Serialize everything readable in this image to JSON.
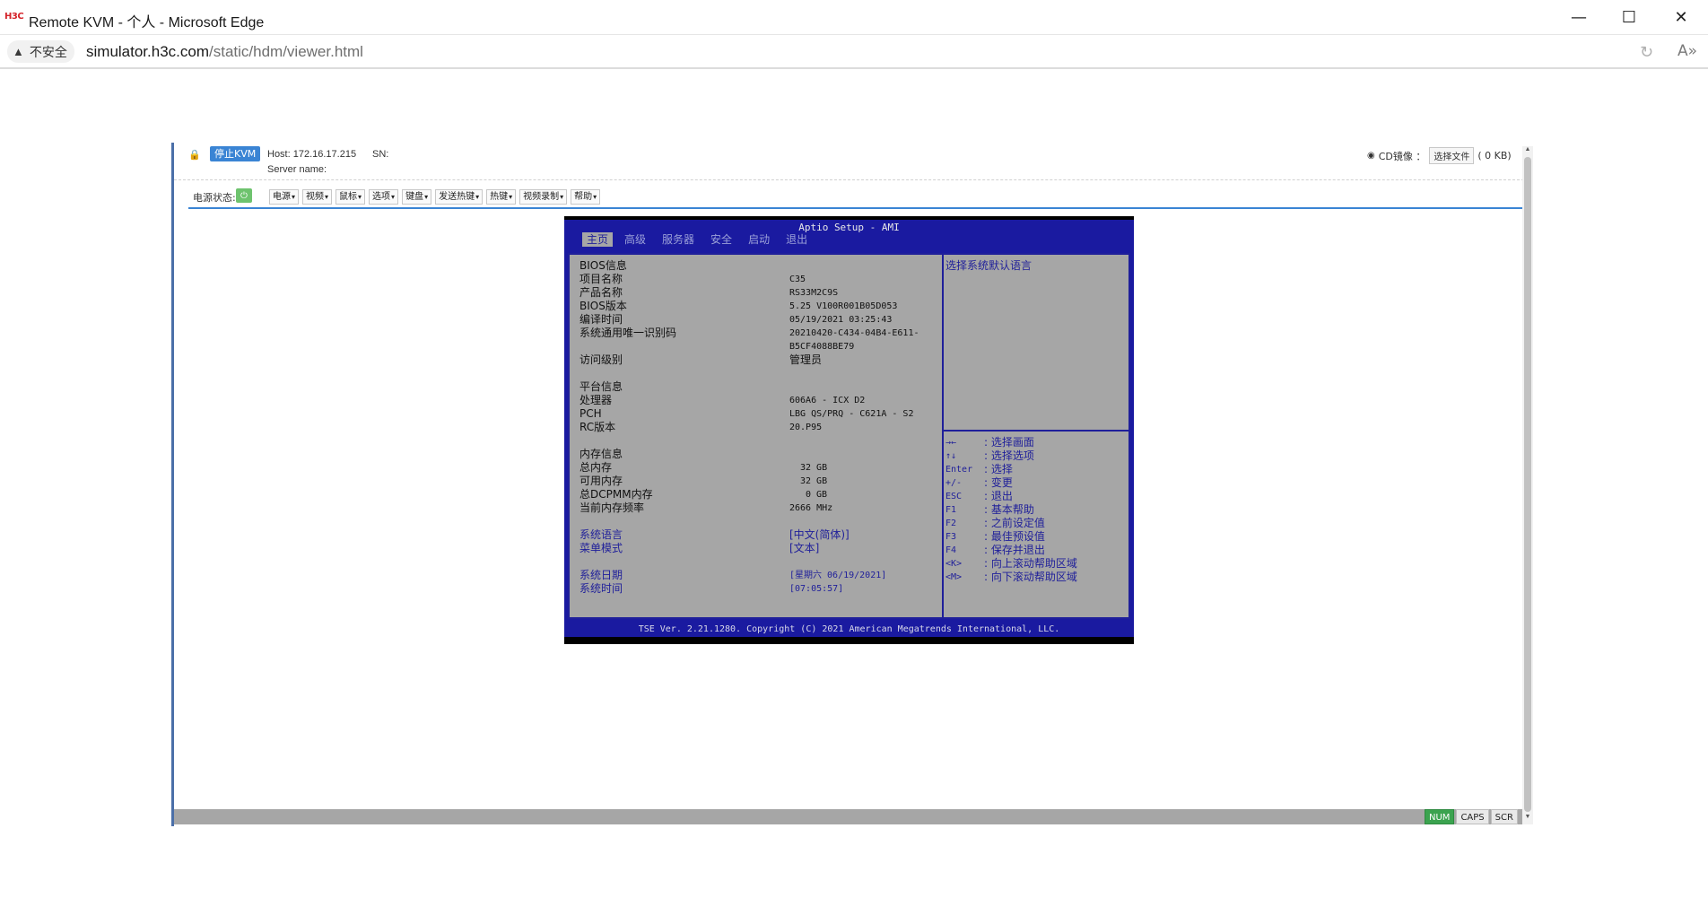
{
  "window": {
    "logo": "H3C",
    "title": "Remote KVM - 个人 - Microsoft Edge",
    "minimize": "—",
    "maximize": "☐",
    "close": "✕"
  },
  "addressbar": {
    "security_text": "不安全",
    "url_host": "simulator.h3c.com",
    "url_path": "/static/hdm/viewer.html"
  },
  "kvm": {
    "stop_button": "停止KVM",
    "host": "Host: 172.16.17.215",
    "sn": "SN:",
    "server_name": "Server name:",
    "cd_label": "CD镜像 ：",
    "choose_file": "选择文件",
    "cd_size": "( 0 KB)",
    "power_status_label": "电源状态:",
    "menus": [
      "电源",
      "视频",
      "鼠标",
      "选项",
      "键盘",
      "发送热键",
      "热键",
      "视频录制",
      "帮助"
    ],
    "lock_keys": [
      {
        "label": "NUM",
        "on": true
      },
      {
        "label": "CAPS",
        "on": false
      },
      {
        "label": "SCR",
        "on": false
      }
    ]
  },
  "bios": {
    "title": "Aptio Setup - AMI",
    "tabs": [
      "主页",
      "高级",
      "服务器",
      "安全",
      "启动",
      "退出"
    ],
    "active_tab": "主页",
    "rows": [
      {
        "label": "BIOS信息",
        "value": ""
      },
      {
        "label": "项目名称",
        "value": "C35"
      },
      {
        "label": "产品名称",
        "value": "RS33M2C9S"
      },
      {
        "label": "BIOS版本",
        "value": "5.25 V100R001B05D053"
      },
      {
        "label": "编译时间",
        "value": "05/19/2021 03:25:43"
      },
      {
        "label": "系统通用唯一识别码",
        "value": "20210420-C434-04B4-E611-"
      },
      {
        "label": "",
        "value": "B5CF4088BE79"
      },
      {
        "label": "访问级别",
        "value": "管理员"
      },
      {
        "label": "平台信息",
        "value": ""
      },
      {
        "label": "处理器",
        "value": "606A6 - ICX D2"
      },
      {
        "label": "PCH",
        "value": "LBG QS/PRQ - C621A - S2"
      },
      {
        "label": "RC版本",
        "value": "20.P95"
      },
      {
        "label": "内存信息",
        "value": ""
      },
      {
        "label": "总内存",
        "value": "32 GB"
      },
      {
        "label": "可用内存",
        "value": "32 GB"
      },
      {
        "label": "总DCPMM内存",
        "value": "0 GB"
      },
      {
        "label": "当前内存频率",
        "value": "2666 MHz"
      },
      {
        "label": "系统语言",
        "value": "[中文(简体)]"
      },
      {
        "label": "菜单模式",
        "value": "[文本]"
      },
      {
        "label": "系统日期",
        "value": "[星期六 06/19/2021]"
      },
      {
        "label": "系统时间",
        "value": "[07:05:57]"
      }
    ],
    "help_text": "选择系统默认语言",
    "keys": [
      {
        "key": "→←",
        "desc": ": 选择画面"
      },
      {
        "key": "↑↓",
        "desc": ": 选择选项"
      },
      {
        "key": "Enter",
        "desc": ": 选择"
      },
      {
        "key": "+/-",
        "desc": ": 变更"
      },
      {
        "key": "ESC",
        "desc": ": 退出"
      },
      {
        "key": "F1",
        "desc": ": 基本帮助"
      },
      {
        "key": "F2",
        "desc": ": 之前设定值"
      },
      {
        "key": "F3",
        "desc": ": 最佳预设值"
      },
      {
        "key": "F4",
        "desc": ": 保存并退出"
      },
      {
        "key": "<K>",
        "desc": ": 向上滚动帮助区域"
      },
      {
        "key": "<M>",
        "desc": ": 向下滚动帮助区域"
      }
    ],
    "footer": "TSE Ver. 2.21.1280. Copyright (C) 2021 American Megatrends International, LLC."
  },
  "colors": {
    "bios_blue": "#1a1aa0",
    "bios_gray": "#a6a6a6",
    "accent": "#3a84d4",
    "num_on": "#3ba34f"
  }
}
